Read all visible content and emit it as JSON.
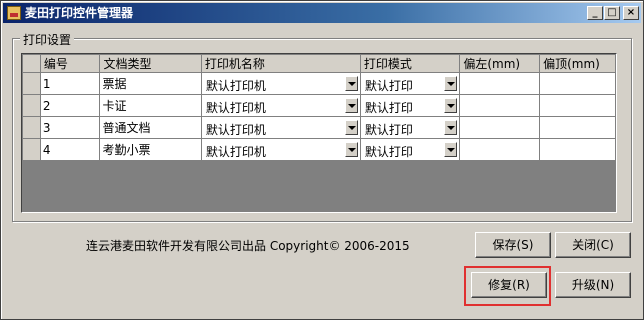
{
  "window": {
    "title": "麦田打印控件管理器",
    "min_glyph": "_",
    "max_glyph": "□",
    "close_glyph": "×"
  },
  "group": {
    "label": "打印设置"
  },
  "grid": {
    "headers": [
      "编号",
      "文档类型",
      "打印机名称",
      "打印模式",
      "偏左(mm)",
      "偏顶(mm)"
    ],
    "rows": [
      {
        "id": "1",
        "doc_type": "票据",
        "printer": "默认打印机",
        "mode": "默认打印",
        "left": "",
        "top": ""
      },
      {
        "id": "2",
        "doc_type": "卡证",
        "printer": "默认打印机",
        "mode": "默认打印",
        "left": "",
        "top": ""
      },
      {
        "id": "3",
        "doc_type": "普通文档",
        "printer": "默认打印机",
        "mode": "默认打印",
        "left": "",
        "top": ""
      },
      {
        "id": "4",
        "doc_type": "考勤小票",
        "printer": "默认打印机",
        "mode": "默认打印",
        "left": "",
        "top": ""
      }
    ]
  },
  "footer": {
    "credit": "连云港麦田软件开发有限公司出品 Copyright© 2006-2015"
  },
  "buttons": {
    "save": "保存(S)",
    "close": "关闭(C)",
    "repair": "修复(R)",
    "upgrade": "升级(N)"
  },
  "colors": {
    "titlebar_start": "#0a246a",
    "highlight": "#e03030",
    "face": "#d4d0c8"
  }
}
